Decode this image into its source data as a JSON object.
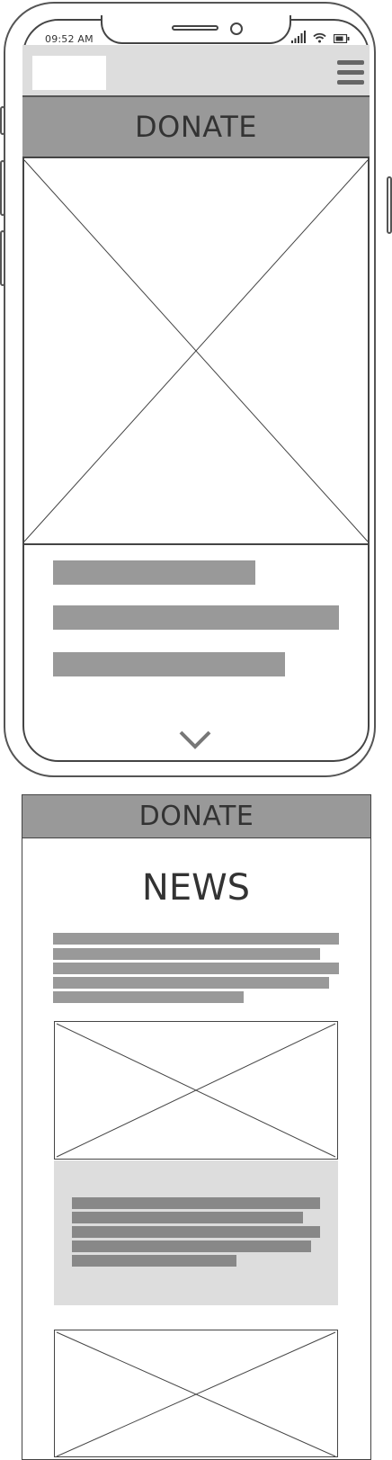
{
  "status_bar": {
    "time": "09:52 AM",
    "icons": [
      "signal-icon",
      "wifi-icon",
      "battery-icon"
    ]
  },
  "header": {
    "logo_icon": "logo-placeholder",
    "menu_icon": "hamburger-menu-icon"
  },
  "hero": {
    "banner_label": "DONATE",
    "image_icon": "image-placeholder",
    "text_line_count": 3,
    "scroll_icon": "chevron-down-icon"
  },
  "news_section": {
    "banner_label": "DONATE",
    "title": "NEWS",
    "intro_line_count": 5,
    "card": {
      "image_icon": "image-placeholder",
      "text_line_count": 5
    }
  },
  "colors": {
    "placeholder_bar": "#999999",
    "light_panel": "#dddddd",
    "outline": "#444444"
  }
}
